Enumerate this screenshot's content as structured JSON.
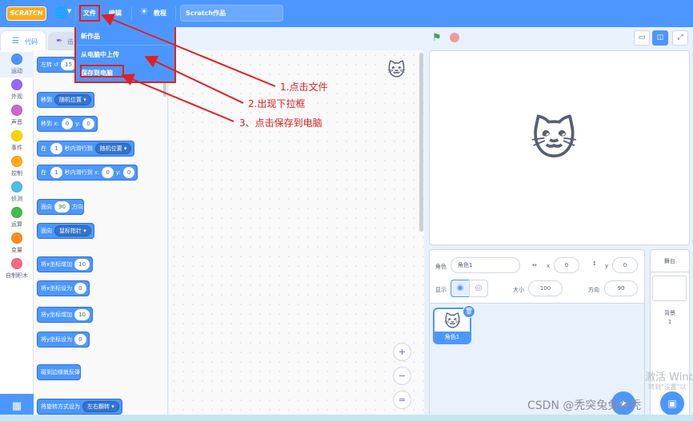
{
  "menubar": {
    "logo": "SCRATCH",
    "file": "文件",
    "edit": "编辑",
    "tutorials": "教程",
    "project_title": "Scratch作品"
  },
  "file_menu": {
    "items": [
      "新作品",
      "从电脑中上传",
      "保存到电脑"
    ]
  },
  "tabs": {
    "code": "代码",
    "costumes": "造"
  },
  "categories": [
    {
      "name": "运动",
      "color": "#4c97ff"
    },
    {
      "name": "外观",
      "color": "#9966ff"
    },
    {
      "name": "声音",
      "color": "#cf63cf"
    },
    {
      "name": "事件",
      "color": "#ffd500"
    },
    {
      "name": "控制",
      "color": "#ffab19"
    },
    {
      "name": "侦测",
      "color": "#4cbfe6"
    },
    {
      "name": "运算",
      "color": "#40bf4a"
    },
    {
      "name": "变量",
      "color": "#ff8c1a"
    },
    {
      "name": "自制积木",
      "color": "#ff6680"
    }
  ],
  "blocks": {
    "turn_left": "左转",
    "turn_left_val": "15",
    "goto": "移到",
    "goto_random": "随机位置",
    "goto_xy": "移到 x:",
    "goto_xy_x": "0",
    "goto_xy_y_lbl": "y:",
    "goto_xy_y": "0",
    "glide_in": "在",
    "glide_secs": "1",
    "glide_to": "秒内滑行到",
    "glide_random": "随机位置",
    "glide_in2": "在",
    "glide_secs2": "1",
    "glide_xy": "秒内滑行到 x:",
    "glide_x": "0",
    "glide_y_lbl": "y:",
    "glide_y": "0",
    "point_dir": "面向",
    "point_dir_val": "90",
    "point_dir_unit": "方向",
    "point_towards": "面向",
    "point_towards_val": "鼠标指针",
    "change_x": "将x坐标增加",
    "change_x_val": "10",
    "set_x": "将x坐标设为",
    "set_x_val": "0",
    "change_y": "将y坐标增加",
    "change_y_val": "10",
    "set_y": "将y坐标设为",
    "set_y_val": "0",
    "bounce": "碰到边缘就反弹",
    "rotation_style": "将旋转方式设为",
    "rotation_style_val": "左右翻转"
  },
  "zoom": {
    "in": "+",
    "out": "−",
    "reset": "="
  },
  "sprite_info": {
    "sprite_label": "角色",
    "sprite_name": "角色1",
    "x_label": "x",
    "x_value": "0",
    "y_label": "y",
    "y_value": "0",
    "show_label": "显示",
    "size_label": "大小",
    "size_value": "100",
    "direction_label": "方向",
    "direction_value": "90"
  },
  "sprite_list": {
    "tile_name": "角色1"
  },
  "stage_pane": {
    "title": "舞台",
    "backdrop_label": "背景",
    "backdrop_count": "1"
  },
  "annotations": {
    "a1": "1.点击文件",
    "a2": "2.出现下拉框",
    "a3": "3、点击保存到电脑"
  },
  "watermarks": {
    "windows_line1": "激活 Wind",
    "windows_line2": "转到\"设置\"以",
    "csdn": "CSDN @秃突兔兔突秃"
  },
  "colors": {
    "accent": "#4c97ff",
    "annotation": "#e02020",
    "motion_block": "#4c97ff"
  }
}
